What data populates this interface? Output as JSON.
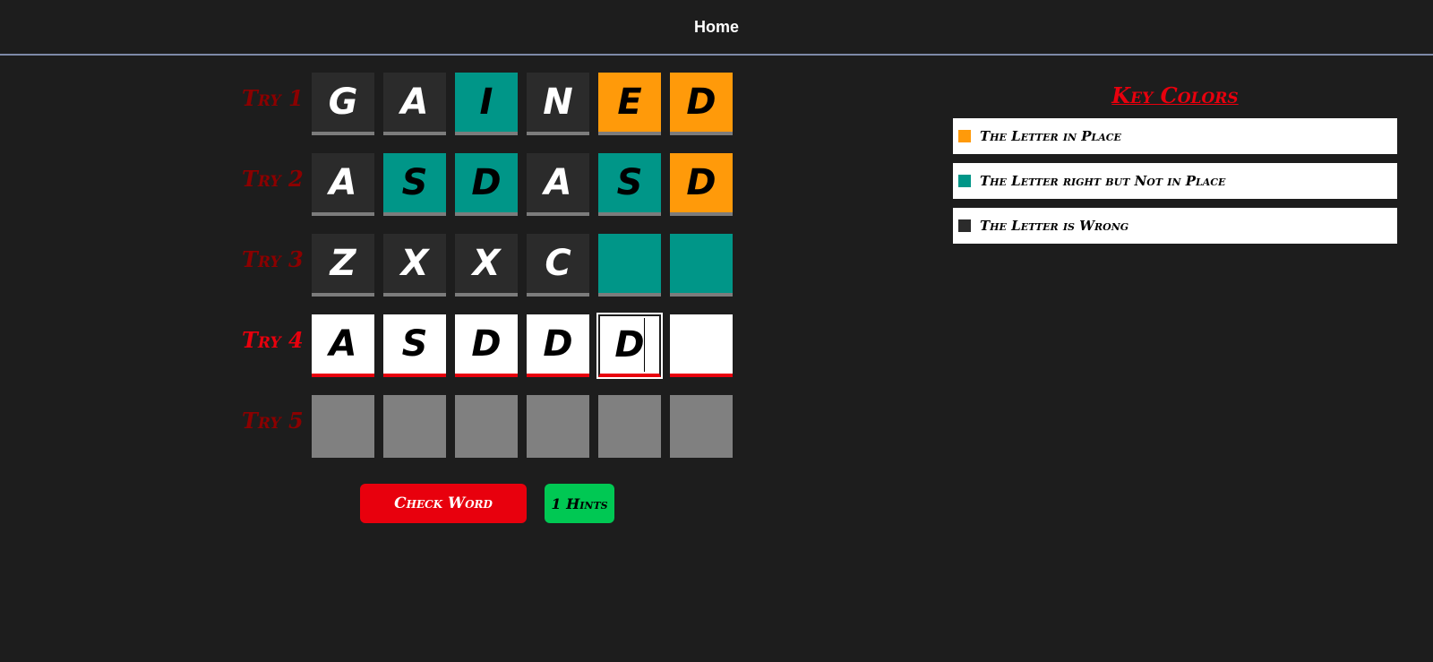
{
  "nav": {
    "home": "Home"
  },
  "board": {
    "rows": [
      {
        "label": "Try 1",
        "cells": [
          {
            "letter": "G",
            "state": "dark"
          },
          {
            "letter": "A",
            "state": "dark"
          },
          {
            "letter": "I",
            "state": "teal"
          },
          {
            "letter": "N",
            "state": "dark"
          },
          {
            "letter": "E",
            "state": "orange"
          },
          {
            "letter": "D",
            "state": "orange"
          }
        ]
      },
      {
        "label": "Try 2",
        "cells": [
          {
            "letter": "A",
            "state": "dark"
          },
          {
            "letter": "S",
            "state": "teal"
          },
          {
            "letter": "D",
            "state": "teal"
          },
          {
            "letter": "A",
            "state": "dark"
          },
          {
            "letter": "S",
            "state": "teal"
          },
          {
            "letter": "D",
            "state": "orange"
          }
        ]
      },
      {
        "label": "Try 3",
        "cells": [
          {
            "letter": "Z",
            "state": "dark"
          },
          {
            "letter": "X",
            "state": "dark"
          },
          {
            "letter": "X",
            "state": "dark"
          },
          {
            "letter": "C",
            "state": "dark"
          },
          {
            "letter": "",
            "state": "teal"
          },
          {
            "letter": "",
            "state": "teal"
          }
        ]
      },
      {
        "label": "Try 4",
        "cells": [
          {
            "letter": "A",
            "state": "input"
          },
          {
            "letter": "S",
            "state": "input"
          },
          {
            "letter": "D",
            "state": "input"
          },
          {
            "letter": "D",
            "state": "input"
          },
          {
            "letter": "D",
            "state": "input"
          },
          {
            "letter": "",
            "state": "input"
          }
        ]
      },
      {
        "label": "Try 5",
        "cells": [
          {
            "letter": "",
            "state": "empty"
          },
          {
            "letter": "",
            "state": "empty"
          },
          {
            "letter": "",
            "state": "empty"
          },
          {
            "letter": "",
            "state": "empty"
          },
          {
            "letter": "",
            "state": "empty"
          },
          {
            "letter": "",
            "state": "empty"
          }
        ]
      }
    ],
    "active_row": 3,
    "focused_cell": 4
  },
  "actions": {
    "check_label": "Check Word",
    "hints_label": "1 Hints"
  },
  "legend": {
    "title": "Key Colors",
    "items": [
      {
        "text": "The Letter in Place",
        "color": "#ff9a0a"
      },
      {
        "text": "The Letter right but Not in Place",
        "color": "#009688"
      },
      {
        "text": "The Letter is Wrong",
        "color": "#2b2b2b"
      }
    ]
  }
}
